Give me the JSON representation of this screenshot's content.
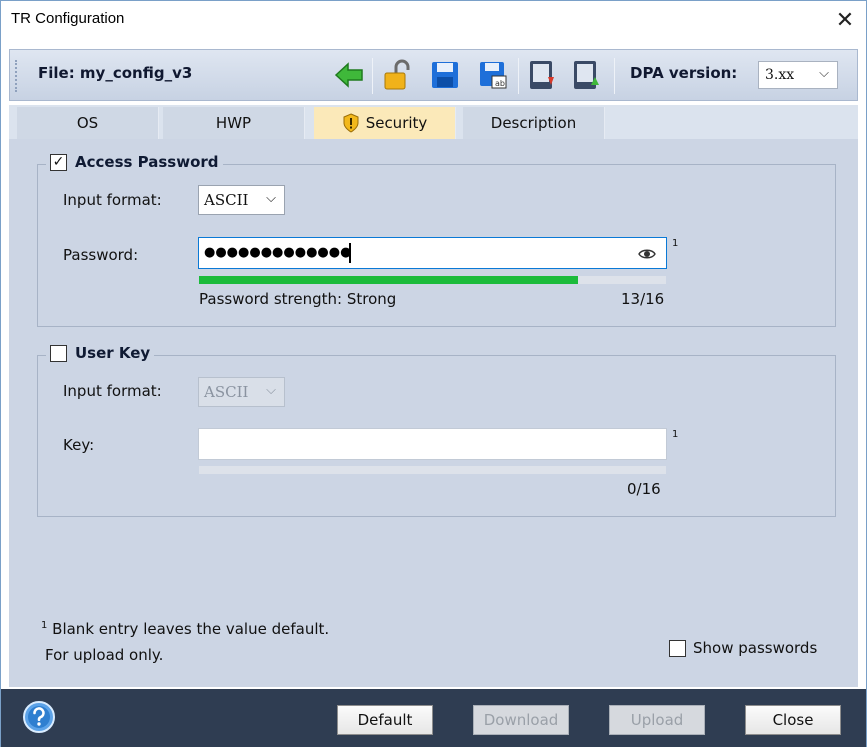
{
  "window": {
    "title": "TR Configuration",
    "close_glyph": "✕"
  },
  "toolbar": {
    "file_label": "File: my_config_v3",
    "buttons": [
      {
        "name": "back-arrow-icon"
      },
      {
        "name": "unlock-icon"
      },
      {
        "name": "save-icon"
      },
      {
        "name": "save-as-icon"
      },
      {
        "name": "download-device-icon"
      },
      {
        "name": "upload-device-icon"
      }
    ],
    "dpa_label": "DPA version:",
    "dpa_value": "3.xx"
  },
  "tabs": [
    {
      "label": "OS"
    },
    {
      "label": "HWP"
    },
    {
      "label": "Security",
      "active": true
    },
    {
      "label": "Description"
    }
  ],
  "access_password": {
    "legend": "Access Password",
    "checked": true,
    "check_glyph": "✓",
    "input_format_label": "Input format:",
    "input_format_value": "ASCII",
    "password_label": "Password:",
    "password_mask": "●●●●●●●●●●●●●",
    "footnote_mark": "1",
    "strength_text": "Password strength: Strong",
    "count": "13/16",
    "strength_fraction": 0.8125,
    "strength_color": "#1bbb3b"
  },
  "user_key": {
    "legend": "User Key",
    "checked": false,
    "input_format_label": "Input format:",
    "input_format_value": "ASCII",
    "key_label": "Key:",
    "key_value": "",
    "footnote_mark": "1",
    "count": "0/16"
  },
  "footnote": {
    "mark": "1",
    "line1": "Blank entry leaves the value default.",
    "line2": "For upload only."
  },
  "show_passwords_label": "Show passwords",
  "buttons": {
    "default": "Default",
    "download": "Download",
    "upload": "Upload",
    "close": "Close"
  },
  "colors": {
    "pane_bg": "#ccd5e4",
    "active_tab": "#fbe9b9",
    "bottom_bar": "#2f3d52",
    "focus_border": "#0a79d6"
  }
}
